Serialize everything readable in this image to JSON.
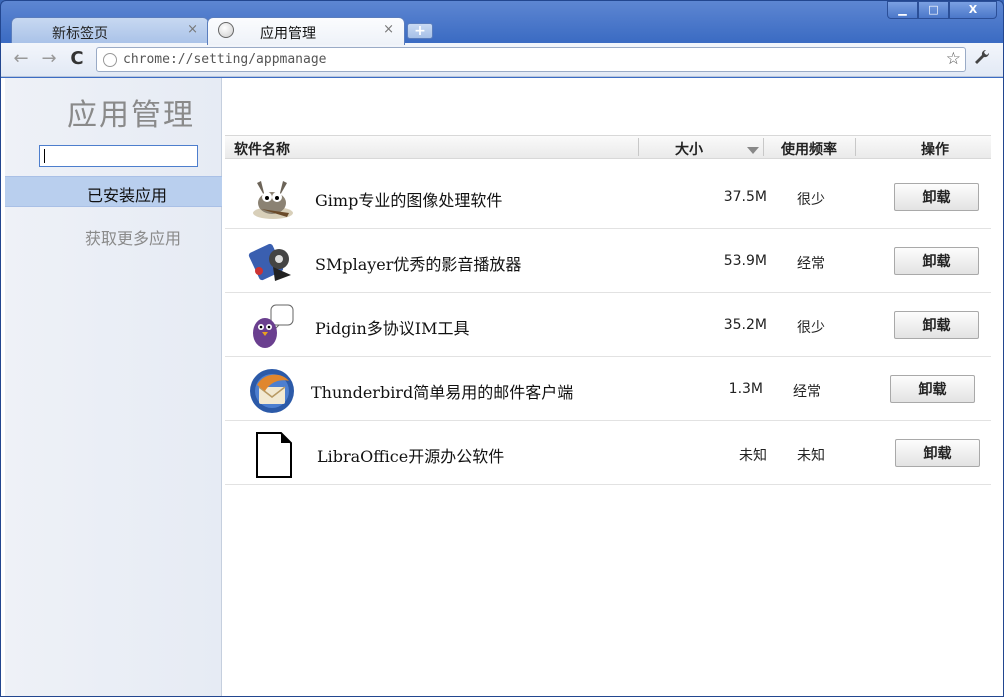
{
  "tabs": [
    {
      "title": "新标签页",
      "close": "×"
    },
    {
      "title": "应用管理",
      "close": "×"
    }
  ],
  "new_tab": "+",
  "window_controls": {
    "minimize": "▁",
    "maximize": "□",
    "close": "X"
  },
  "toolbar": {
    "back": "←",
    "forward": "→",
    "reload": "C",
    "url": "chrome://setting/appmanage",
    "star": "☆",
    "wrench": "🔧"
  },
  "sidebar": {
    "title": "应用管理",
    "search_value": "",
    "items": [
      {
        "label": "已安装应用"
      },
      {
        "label": "获取更多应用"
      }
    ]
  },
  "table": {
    "headers": {
      "name": "软件名称",
      "size": "大小",
      "frequency": "使用频率",
      "action": "操作"
    },
    "rows": [
      {
        "name": "Gimp专业的图像处理软件",
        "size": "37.5M",
        "frequency": "很少",
        "action": "卸载",
        "icon": "gimp-icon"
      },
      {
        "name": "SMplayer优秀的影音播放器",
        "size": "53.9M",
        "frequency": "经常",
        "action": "卸载",
        "icon": "smplayer-icon"
      },
      {
        "name": "Pidgin多协议IM工具",
        "size": "35.2M",
        "frequency": "很少",
        "action": "卸载",
        "icon": "pidgin-icon"
      },
      {
        "name": "Thunderbird简单易用的邮件客户端",
        "size": "1.3M",
        "frequency": "经常",
        "action": "卸载",
        "icon": "thunderbird-icon"
      },
      {
        "name": "LibraOffice开源办公软件",
        "size": "未知",
        "frequency": "未知",
        "action": "卸载",
        "icon": "document-icon"
      }
    ]
  }
}
